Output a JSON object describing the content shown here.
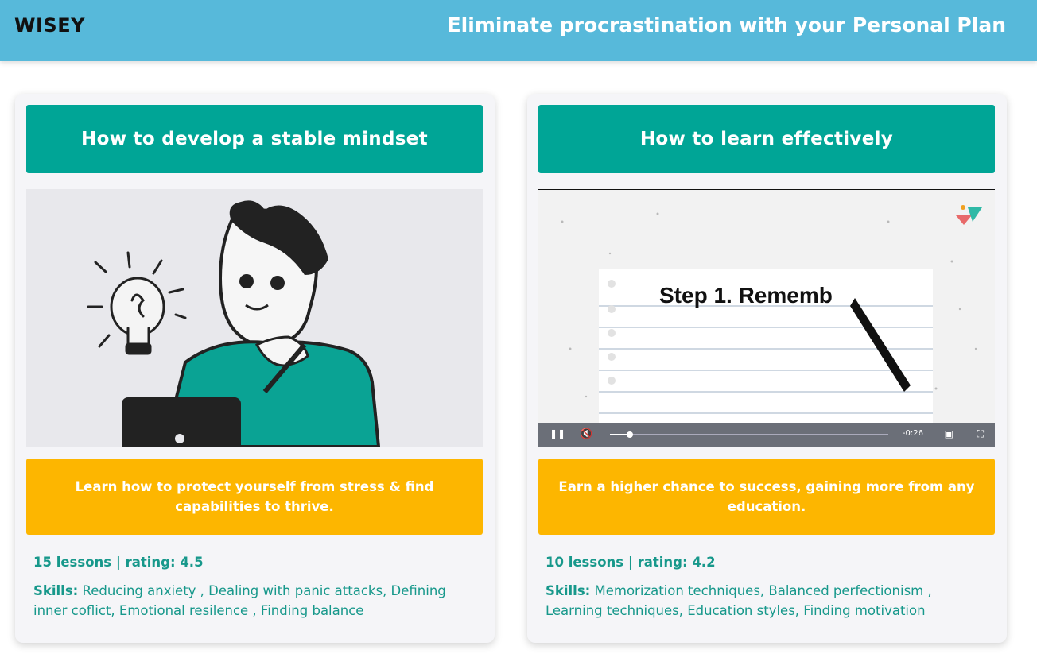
{
  "header": {
    "logo": "WISEY",
    "headline": "Eliminate procrastination with your Personal Plan"
  },
  "courses": [
    {
      "title": "How to develop a stable mindset",
      "description": "Learn how to protect yourself from stress & find capabilities to thrive.",
      "meta": "15 lessons | rating: 4.5",
      "skills_label": "Skills:",
      "skills": "Reducing anxiety , Dealing with panic attacks, Defining inner coflict, Emotional resilence , Finding balance"
    },
    {
      "title": "How to learn effectively",
      "description": "Earn a higher chance to success, gaining more from any education.",
      "meta": "10 lessons | rating: 4.2",
      "skills_label": "Skills:",
      "skills": "Memorization techniques, Balanced perfectionism , Learning techniques, Education styles, Finding motivation",
      "video": {
        "caption": "Step 1. Rememb",
        "time": "-0:26",
        "progress": 0.07
      }
    }
  ],
  "colors": {
    "header": "#57b9da",
    "title_bg": "#00a596",
    "desc_bg": "#fdb600",
    "meta_text": "#17988b"
  }
}
